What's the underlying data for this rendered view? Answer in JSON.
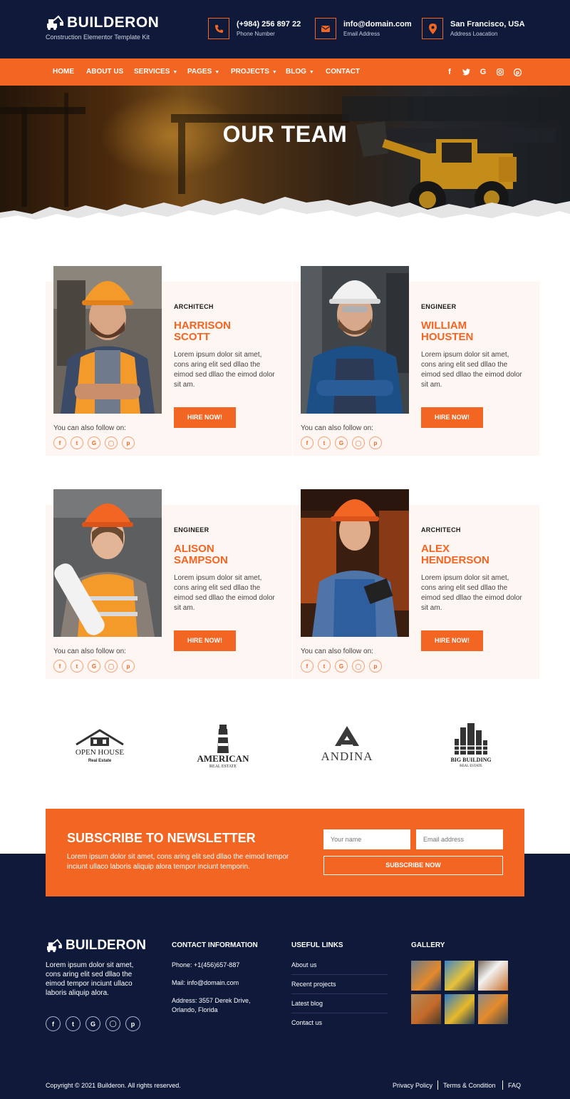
{
  "brand": {
    "name": "BUILDERON",
    "tagline": "Construction Elementor Template Kit"
  },
  "header": {
    "phone": {
      "value": "(+984) 256 897 22",
      "label": "Phone Number",
      "icon": "phone-icon"
    },
    "email": {
      "value": "info@domain.com",
      "label": "Email Address",
      "icon": "mail-icon"
    },
    "address": {
      "value": "San Francisco, USA",
      "label": "Address Loacation",
      "icon": "map-pin-icon"
    }
  },
  "nav": {
    "items": [
      {
        "label": "HOME",
        "dropdown": false
      },
      {
        "label": "ABOUT US",
        "dropdown": false
      },
      {
        "label": "SERVICES",
        "dropdown": true
      },
      {
        "label": "PAGES",
        "dropdown": true
      },
      {
        "label": "PROJECTS",
        "dropdown": true
      },
      {
        "label": "BLOG",
        "dropdown": true
      },
      {
        "label": "CONTACT",
        "dropdown": false
      }
    ],
    "social": [
      "f",
      "t",
      "G",
      "ig",
      "p"
    ]
  },
  "hero": {
    "title": "OUR TEAM"
  },
  "team": [
    {
      "role": "ARCHITECH",
      "name_first": "HARRISON",
      "name_last": "SCOTT",
      "bio": "Lorem ipsum dolor sit amet, cons aring elit sed dllao the eimod sed dllao the eimod dolor sit am.",
      "button": "HIRE NOW!",
      "follow": "You can also follow on:"
    },
    {
      "role": "ENGINEER",
      "name_first": "WILLIAM",
      "name_last": "HOUSTEN",
      "bio": "Lorem ipsum dolor sit amet, cons aring elit sed dllao the eimod sed dllao the eimod dolor sit am.",
      "button": "HIRE NOW!",
      "follow": "You can also follow on:"
    },
    {
      "role": "ENGINEER",
      "name_first": "ALISON",
      "name_last": "SAMPSON",
      "bio": "Lorem ipsum dolor sit amet, cons aring elit sed dllao the eimod sed dllao the eimod dolor sit am.",
      "button": "HIRE NOW!",
      "follow": "You can also follow on:"
    },
    {
      "role": "ARCHITECH",
      "name_first": "ALEX",
      "name_last": "HENDERSON",
      "bio": "Lorem ipsum dolor sit amet, cons aring elit sed dllao the eimod sed dllao the eimod dolor sit am.",
      "button": "HIRE NOW!",
      "follow": "You can also follow on:"
    }
  ],
  "brands": [
    {
      "name": "OPEN HOUSE",
      "sub": "Real Estate"
    },
    {
      "name": "AMERICAN",
      "sub": "REAL ESTATE"
    },
    {
      "name": "ANDINA",
      "sub": ""
    },
    {
      "name": "BIG BUILDING",
      "sub": "REAL ESTATE"
    }
  ],
  "newsletter": {
    "title": "SUBSCRIBE TO NEWSLETTER",
    "description": "Lorem ipsum dolor sit amet, cons aring elit sed dllao the eimod tempor inciunt ullaco laboris aliquip alora tempor inciunt temporin.",
    "name_placeholder": "Your name",
    "email_placeholder": "Email address",
    "button": "SUBSCRIBE NOW"
  },
  "footer": {
    "about": "Lorem ipsum dolor sit amet, cons aring elit sed dllao the eimod tempor inciunt ullaco laboris aliquip alora.",
    "contact_heading": "CONTACT INFORMATION",
    "phone": "Phone: +1(456)657-887",
    "mail": "Mail: info@domain.com",
    "address": "Address: 3557 Derek Drive, Orlando, Florida",
    "links_heading": "USEFUL LINKS",
    "links": [
      "About us",
      "Recent projects",
      "Latest blog",
      "Contact us"
    ],
    "gallery_heading": "GALLERY",
    "copyright": "Copyright © 2021 Builderon. All rights reserved.",
    "bottom_links": [
      "Privacy Policy",
      "Terms & Condition",
      "FAQ"
    ]
  },
  "colors": {
    "accent": "#f26522",
    "navy": "#0f1a3a"
  }
}
